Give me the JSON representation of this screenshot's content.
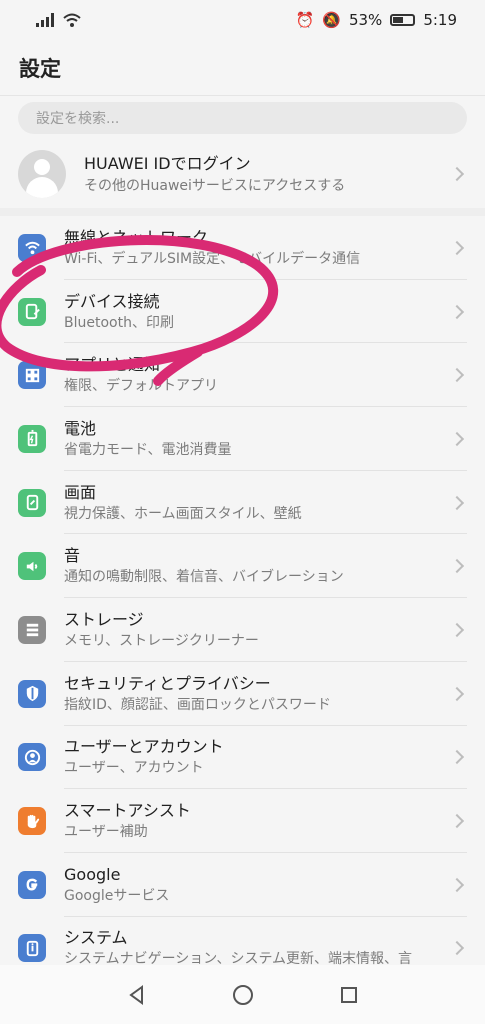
{
  "status": {
    "battery": "53%",
    "time": "5:19",
    "alarm_icon": "alarm-icon",
    "mute_icon": "mute-icon",
    "battery_icon": "battery-icon"
  },
  "header": {
    "title": "設定"
  },
  "search": {
    "placeholder": "設定を検索..."
  },
  "account": {
    "title": "HUAWEI IDでログイン",
    "subtitle": "その他のHuaweiサービスにアクセスする"
  },
  "menu": {
    "items": [
      {
        "title": "無線とネットワーク",
        "subtitle": "Wi-Fi、デュアルSIM設定、モバイルデータ通信",
        "icon": "wifi-icon",
        "color": "#4a7ecf"
      },
      {
        "title": "デバイス接続",
        "subtitle": "Bluetooth、印刷",
        "icon": "device-connection-icon",
        "color": "#4fc27a"
      },
      {
        "title": "アプリと通知",
        "subtitle": "権限、デフォルトアプリ",
        "icon": "apps-icon",
        "color": "#4a7ecf"
      },
      {
        "title": "電池",
        "subtitle": "省電力モード、電池消費量",
        "icon": "battery-icon",
        "color": "#4fc27a"
      },
      {
        "title": "画面",
        "subtitle": "視力保護、ホーム画面スタイル、壁紙",
        "icon": "display-icon",
        "color": "#4fc27a"
      },
      {
        "title": "音",
        "subtitle": "通知の鳴動制限、着信音、バイブレーション",
        "icon": "speaker-icon",
        "color": "#4fc27a"
      },
      {
        "title": "ストレージ",
        "subtitle": "メモリ、ストレージクリーナー",
        "icon": "storage-icon",
        "color": "#8d8d8d"
      },
      {
        "title": "セキュリティとプライバシー",
        "subtitle": "指紋ID、顔認証、画面ロックとパスワード",
        "icon": "shield-icon",
        "color": "#4a7ecf"
      },
      {
        "title": "ユーザーとアカウント",
        "subtitle": "ユーザー、アカウント",
        "icon": "user-icon",
        "color": "#4a7ecf"
      },
      {
        "title": "スマートアシスト",
        "subtitle": "ユーザー補助",
        "icon": "hand-icon",
        "color": "#ef7d2f"
      },
      {
        "title": "Google",
        "subtitle": "Googleサービス",
        "icon": "google-icon",
        "color": "#4a7ecf"
      },
      {
        "title": "システム",
        "subtitle": "システムナビゲーション、システム更新、端末情報、言",
        "icon": "info-icon",
        "color": "#4a7ecf"
      }
    ]
  },
  "annotation": {
    "color": "#d92a73",
    "shape": "hand-drawn-circle-around-device-connection"
  },
  "nav": {
    "back_icon": "back-icon",
    "home_icon": "home-icon",
    "recents_icon": "recents-icon"
  }
}
